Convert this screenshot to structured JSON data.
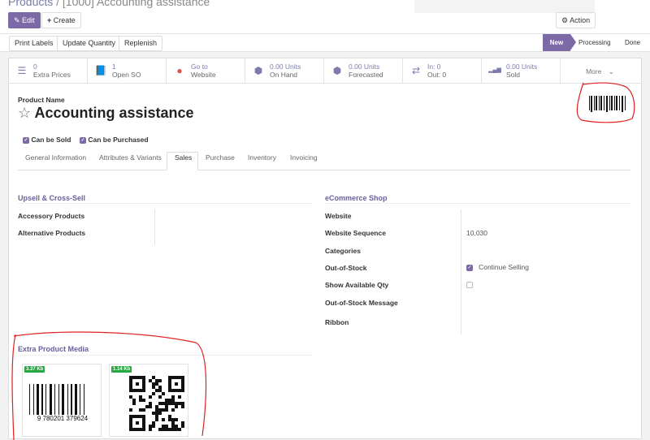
{
  "breadcrumb": {
    "parent": "Products",
    "current": "[1000] Accounting assistance"
  },
  "toolbar": {
    "edit": "Edit",
    "create": "Create",
    "action": "Action"
  },
  "header_buttons": [
    "Print Labels",
    "Update Quantity",
    "Replenish"
  ],
  "statusbar": [
    "New",
    "Processing",
    "Done"
  ],
  "stats": [
    {
      "icon": "list-icon",
      "value": "0",
      "label": "Extra Prices"
    },
    {
      "icon": "book-icon",
      "value": "1",
      "label": "Open SO"
    },
    {
      "icon": "globe-icon",
      "value": "Go to",
      "label": "Website"
    },
    {
      "icon": "cubes-icon",
      "value": "0.00 Units",
      "label": "On Hand"
    },
    {
      "icon": "cubes-icon",
      "value": "0.00 Units",
      "label": "Forecasted"
    },
    {
      "icon": "exchange-icon",
      "value": "In:   0",
      "label": "Out:  0"
    },
    {
      "icon": "signal-icon",
      "value": "0.00 Units",
      "label": "Sold"
    }
  ],
  "more": "More",
  "product": {
    "name_label": "Product Name",
    "name": "Accounting assistance",
    "can_be_sold": "Can be Sold",
    "can_be_purchased": "Can be Purchased",
    "barcode": "9 780201 379624"
  },
  "tabs": [
    "General Information",
    "Attributes & Variants",
    "Sales",
    "Purchase",
    "Inventory",
    "Invoicing"
  ],
  "upsell": {
    "title": "Upsell & Cross-Sell",
    "fields": [
      "Accessory Products",
      "Alternative Products"
    ]
  },
  "ecommerce": {
    "title": "eCommerce Shop",
    "fields": [
      "Website",
      "Website Sequence",
      "Categories",
      "Out-of-Stock",
      "Show Available Qty",
      "Out-of-Stock Message",
      "Ribbon"
    ],
    "sequence": "10,030",
    "continue_selling": "Continue Selling"
  },
  "media": {
    "title": "Extra Product Media",
    "items": [
      {
        "size": "3.37 Kb",
        "caption": "9 780201 379624"
      },
      {
        "size": "1.14 Kb"
      }
    ]
  }
}
